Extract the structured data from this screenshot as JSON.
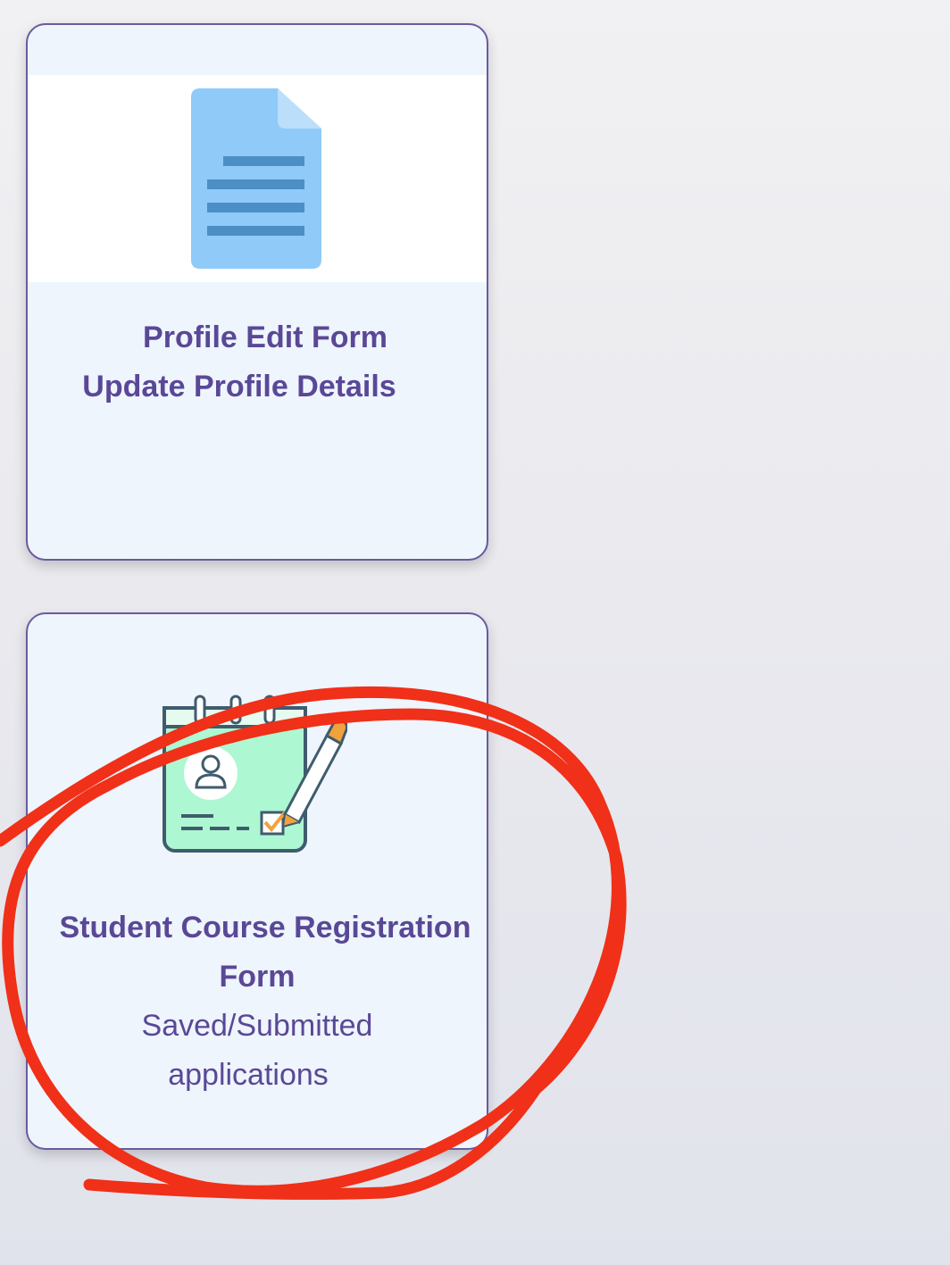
{
  "cards": [
    {
      "title": "Profile Edit Form",
      "subtitle": "Update Profile Details",
      "icon": "document-icon"
    },
    {
      "title_line1": "Student Course Registration",
      "title_line2": "Form",
      "desc_line1": "Saved/Submitted",
      "desc_line2": "applications",
      "icon": "registration-form-icon"
    }
  ],
  "colors": {
    "accent_text": "#5a4896",
    "card_border": "#6a5aa0",
    "card_bg": "#eef5fd",
    "annotation": "#f03018"
  }
}
